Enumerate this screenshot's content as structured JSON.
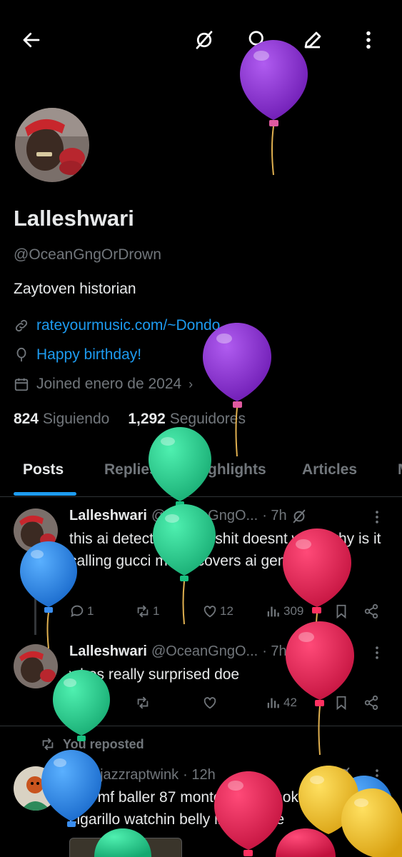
{
  "profile": {
    "name": "Lalleshwari",
    "handle": "@OceanGngOrDrown",
    "bio": "Zaytoven historian",
    "link": "rateyourmusic.com/~Dondo",
    "birthday": "Happy birthday!",
    "joined": "Joined enero de 2024",
    "following_count": "824",
    "following_label": "Siguiendo",
    "followers_count": "1,292",
    "followers_label": "Seguidores"
  },
  "tabs": [
    "Posts",
    "Replies",
    "Highlights",
    "Articles"
  ],
  "posts": [
    {
      "name": "Lalleshwari",
      "handle": "@OceanGngO...",
      "time": "· 7h",
      "text": "this ai detector twitter shit doesnt work why is it calling gucci mane covers ai generated",
      "replies": "1",
      "reposts": "1",
      "likes": "12",
      "views": "309"
    },
    {
      "name": "Lalleshwari",
      "handle": "@OceanGngO...",
      "time": "· 7h",
      "text": "whos really surprised doe",
      "replies": "",
      "reposts": "",
      "likes": "",
      "views": "42"
    },
    {
      "repost_label": "You reposted",
      "handle": "@jazzraptwink",
      "time": "· 12h",
      "text": "ima mf baller 87 monte carlo smoking a cigarillo watchin belly inna tahoe"
    }
  ],
  "colors": {
    "accent": "#1d9bf0",
    "muted": "#71767b",
    "text": "#e7e9ea"
  },
  "icons": {
    "back": "arrow-left-icon",
    "grok": "grok-icon",
    "search": "search-icon",
    "edit": "edit-icon",
    "more": "more-vertical-icon"
  }
}
